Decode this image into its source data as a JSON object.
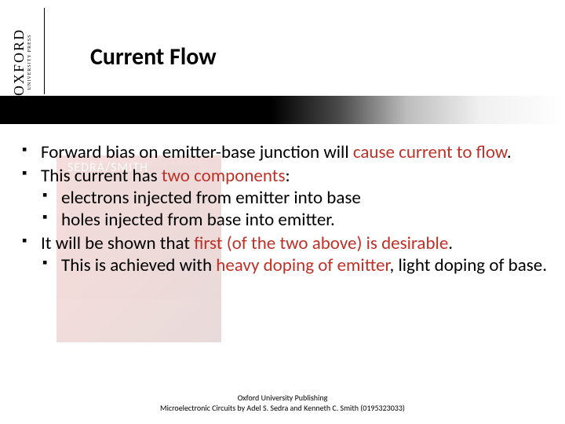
{
  "logo": {
    "main": "OXFORD",
    "sub": "UNIVERSITY PRESS"
  },
  "title": "Current Flow",
  "bg_book_text": "SEDRA/SMITH",
  "bullets": {
    "b1_a": "Forward bias on emitter-base junction will ",
    "b1_hl": "cause current to flow",
    "b1_b": ".",
    "b2_a": "This current has ",
    "b2_hl": "two components",
    "b2_b": ":",
    "b2_1": "electrons injected from emitter into base",
    "b2_2": "holes injected from base into emitter.",
    "b3_a": "It will be shown that ",
    "b3_hl": "first (of the two above) is desirable",
    "b3_b": ".",
    "b3_1_a": "This is achieved with ",
    "b3_1_hl": "heavy doping of emitter",
    "b3_1_b": ", light doping of base."
  },
  "footer": {
    "line1": "Oxford University Publishing",
    "line2": "Microelectronic Circuits by Adel S. Sedra and Kenneth C. Smith (0195323033)"
  }
}
